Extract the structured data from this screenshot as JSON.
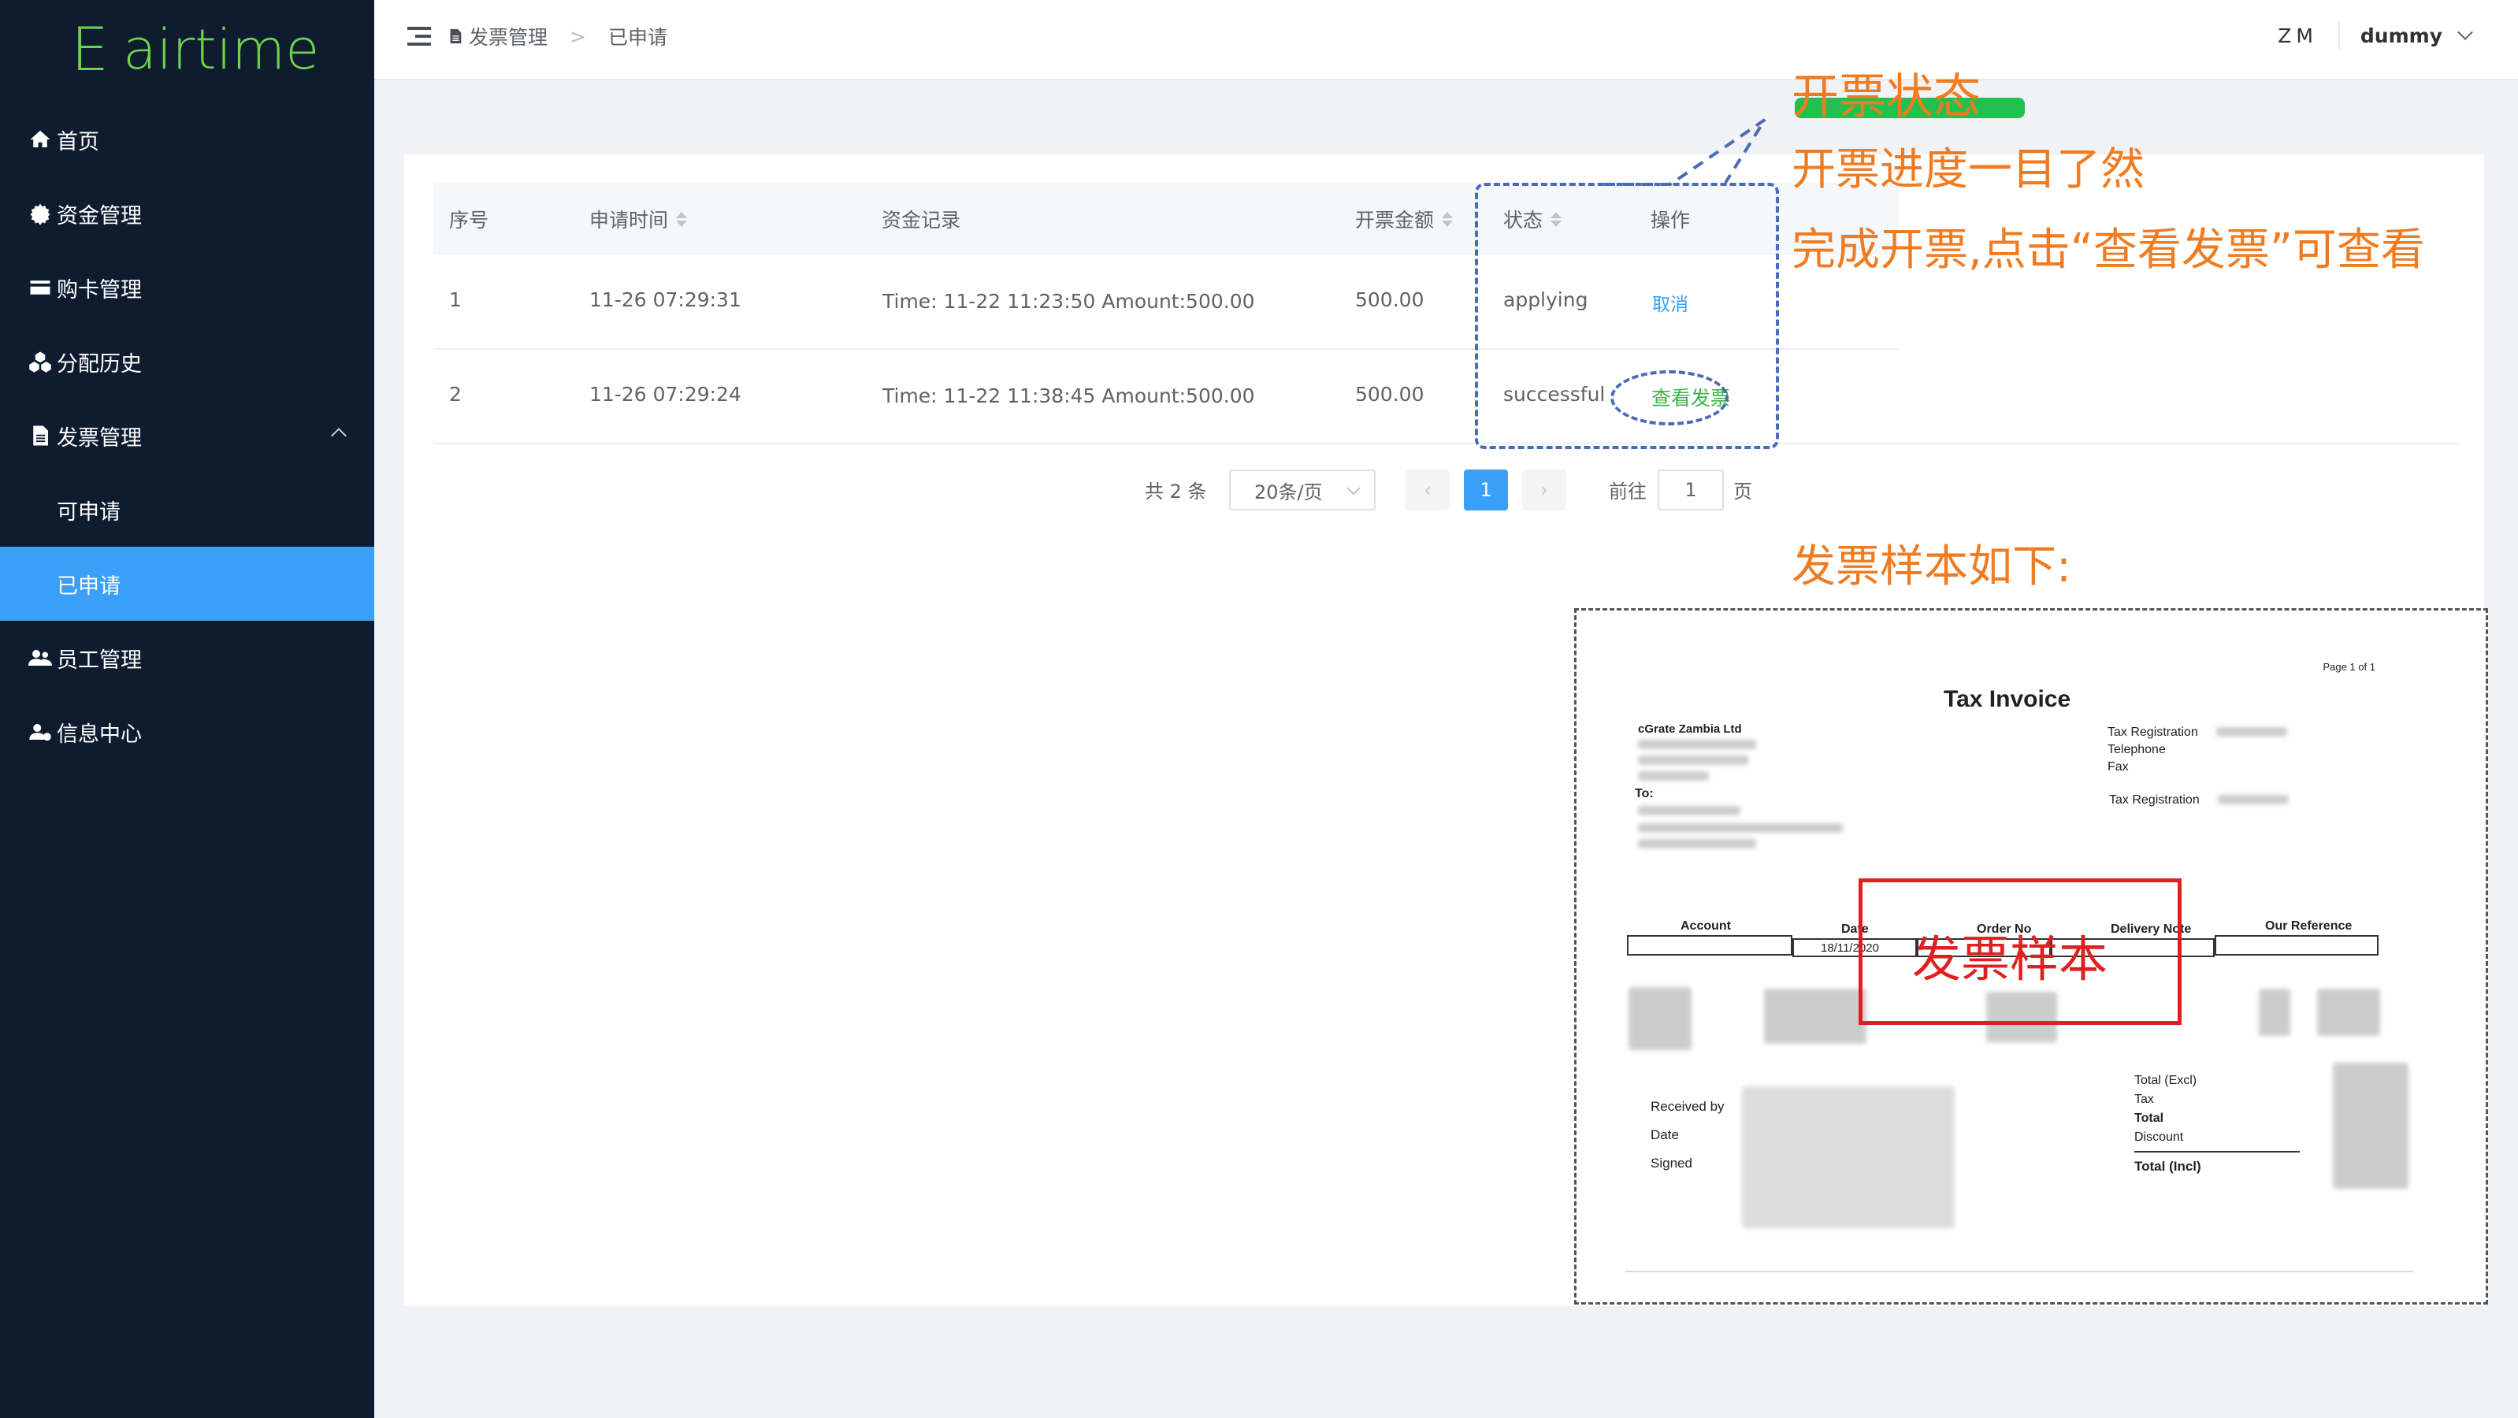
{
  "app": {
    "logo_letter": "E",
    "logo_text": "airtime"
  },
  "sidebar": {
    "items": [
      {
        "label": "首页",
        "icon": "home-icon"
      },
      {
        "label": "资金管理",
        "icon": "gear-icon"
      },
      {
        "label": "购卡管理",
        "icon": "credit-card-icon"
      },
      {
        "label": "分配历史",
        "icon": "cubes-icon"
      },
      {
        "label": "发票管理",
        "icon": "document-icon",
        "expanded": true
      },
      {
        "label": "可申请",
        "icon": ""
      },
      {
        "label": "已申请",
        "icon": "",
        "active": true
      },
      {
        "label": "员工管理",
        "icon": "users-icon"
      },
      {
        "label": "信息中心",
        "icon": "user-info-icon"
      }
    ]
  },
  "header": {
    "breadcrumb": {
      "parent": "发票管理",
      "separator": ">",
      "current": "已申请"
    },
    "initials": "ZM",
    "user": "dummy"
  },
  "table": {
    "columns": {
      "index": "序号",
      "apply_time": "申请时间",
      "fund_record": "资金记录",
      "amount": "开票金额",
      "status": "状态",
      "action": "操作"
    },
    "rows": [
      {
        "index": "1",
        "apply_time": "11-26 07:29:31",
        "fund_record": "Time: 11-22 11:23:50 Amount:500.00",
        "amount": "500.00",
        "status": "applying",
        "action": "取消"
      },
      {
        "index": "2",
        "apply_time": "11-26 07:29:24",
        "fund_record": "Time: 11-22 11:38:45 Amount:500.00",
        "amount": "500.00",
        "status": "successful",
        "action": "查看发票"
      }
    ]
  },
  "pagination": {
    "total": "共 2 条",
    "page_size": "20条/页",
    "prev": "‹",
    "current": "1",
    "next": "›",
    "goto_label": "前往",
    "goto_value": "1",
    "page_suffix": "页"
  },
  "annotations": {
    "title": "开票状态",
    "line1": "开票进度一目了然",
    "line2": "完成开票,点击“查看发票”可查看",
    "sample_heading": "发票样本如下:"
  },
  "invoice": {
    "page": "Page 1 of 1",
    "title": "Tax Invoice",
    "company": "cGrate Zambia Ltd",
    "to": "To:",
    "right_labels": [
      "Tax Registration",
      "Telephone",
      "Fax"
    ],
    "tax_reg2": "Tax Registration",
    "headers": [
      "Account",
      "Date",
      "Order No",
      "Delivery Note",
      "Our Reference"
    ],
    "date_value": "18/11/2020",
    "received_by": "Received by",
    "date_label": "Date",
    "signed": "Signed",
    "totals": [
      "Total (Excl)",
      "Tax",
      "Total",
      "Discount"
    ],
    "total_incl": "Total (Incl)",
    "stamp": "发票样本"
  },
  "colors": {
    "sidebar_bg": "#0f1c30",
    "accent": "#3a9ff6",
    "annotation": "#f07b20",
    "highlight": "#22c14f",
    "success": "#3ab54a"
  }
}
